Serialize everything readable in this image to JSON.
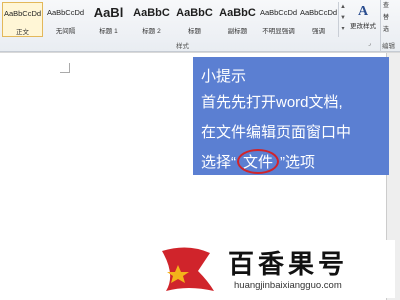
{
  "ribbon": {
    "styles": [
      {
        "preview": "AaBbCcDd",
        "name": "正文",
        "selected": true
      },
      {
        "preview": "AaBbCcDd",
        "name": "无间隔",
        "selected": false
      },
      {
        "preview": "AaBl",
        "name": "标题 1",
        "selected": false
      },
      {
        "preview": "AaBbC",
        "name": "标题 2",
        "selected": false
      },
      {
        "preview": "AaBbC",
        "name": "标题",
        "selected": false
      },
      {
        "preview": "AaBbC",
        "name": "副标题",
        "selected": false
      },
      {
        "preview": "AaBbCcDd",
        "name": "不明显强调",
        "selected": false
      },
      {
        "preview": "AaBbCcDd",
        "name": "强调",
        "selected": false
      }
    ],
    "group_label": "样式",
    "change_style_label": "更改样式",
    "change_style_icon": "A",
    "right_items": [
      "查",
      "替",
      "选"
    ],
    "edit_group_label": "编辑"
  },
  "tip": {
    "title": "小提示",
    "line1": "首先先打开word文档,",
    "line2": "在文件编辑页面窗口中",
    "line3_before": "选择“",
    "line3_highlight": "文件",
    "line3_after": "”选项"
  },
  "watermark": {
    "title": "百香果号",
    "url": "huangjinbaixiangguo.com"
  },
  "colors": {
    "tip_bg": "#5b7fd2",
    "highlight_circle": "#d0242b",
    "logo_red": "#d0242b",
    "logo_star": "#f3b21b"
  }
}
